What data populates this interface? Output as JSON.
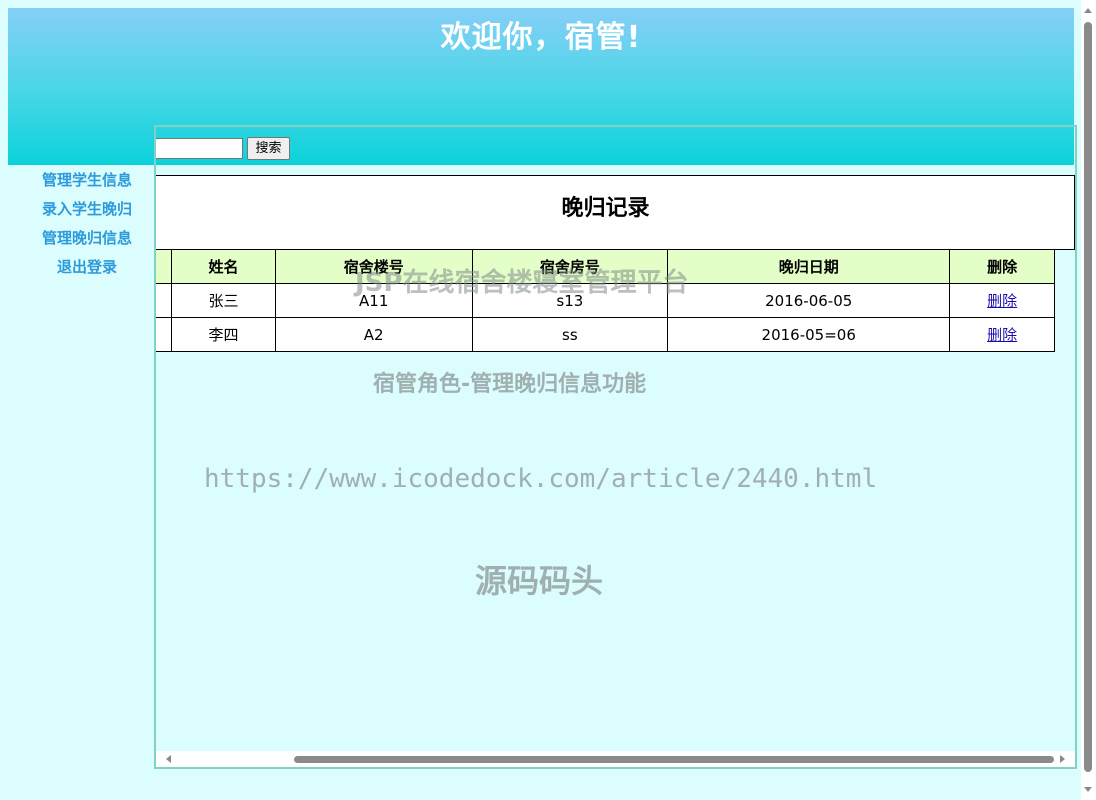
{
  "header": {
    "title": "欢迎你，宿管!"
  },
  "sidebar": {
    "items": [
      {
        "label": "管理学生信息"
      },
      {
        "label": "录入学生晚归"
      },
      {
        "label": "管理晚归信息"
      },
      {
        "label": "退出登录"
      }
    ]
  },
  "search": {
    "value": "",
    "button_label": "搜索"
  },
  "records": {
    "caption": "晚归记录",
    "columns": [
      "",
      "姓名",
      "宿舍楼号",
      "宿舍房号",
      "晚归日期",
      "删除"
    ],
    "rows": [
      {
        "name": "张三",
        "building": "A11",
        "room": "s13",
        "date": "2016-06-05",
        "action": "删除"
      },
      {
        "name": "李四",
        "building": "A2",
        "room": "ss",
        "date": "2016-05=06",
        "action": "删除"
      }
    ]
  },
  "watermarks": {
    "line1": "JSP在线宿舍楼寝室管理平台",
    "line2": "宿管角色-管理晚归信息功能",
    "line3": "https://www.icodedock.com/article/2440.html",
    "line4": "源码码头"
  },
  "colors": {
    "header_top": "#86cff7",
    "header_bottom": "#0bd2da",
    "page_bg": "#dcfdfe",
    "sidebar_link": "#2c9adb",
    "table_header_bg": "#e3ffc7"
  }
}
